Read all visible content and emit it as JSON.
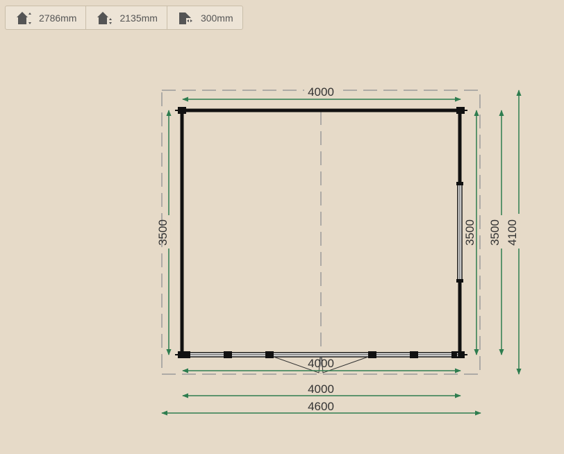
{
  "toolbar": {
    "items": [
      {
        "icon": "roof-height-icon",
        "value": "2786mm"
      },
      {
        "icon": "wall-height-icon",
        "value": "2135mm"
      },
      {
        "icon": "overhang-icon",
        "value": "300mm"
      }
    ]
  },
  "plan": {
    "dimensions": {
      "top_width": "4000",
      "left_depth": "3500",
      "right_depth_inner": "3500",
      "right_depth_outer": "3500",
      "right_depth_total": "4100",
      "bottom_inner_width": "4000",
      "bottom_width": "4000",
      "bottom_total": "4600"
    },
    "colors": {
      "wall": "#111111",
      "dimension_line": "#2e7d4f",
      "dashed_outline": "#9a9a9a",
      "background": "#e6dac8"
    }
  }
}
